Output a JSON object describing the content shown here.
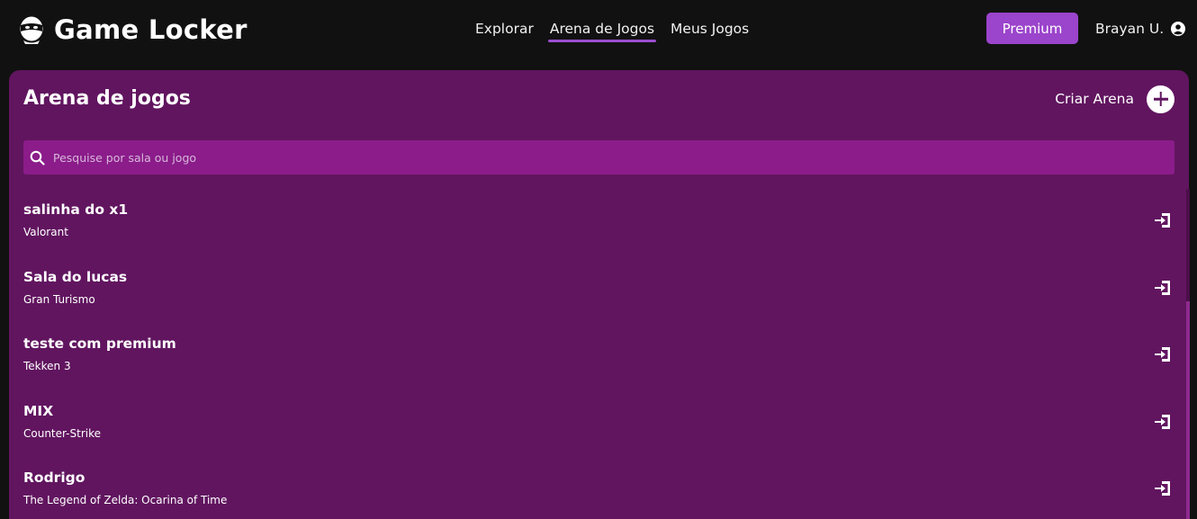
{
  "app": {
    "name": "Game Locker"
  },
  "nav": {
    "items": [
      {
        "label": "Explorar",
        "active": false
      },
      {
        "label": "Arena de Jogos",
        "active": true
      },
      {
        "label": "Meus Jogos",
        "active": false
      }
    ]
  },
  "header": {
    "premium_label": "Premium",
    "user_name": "Brayan U.",
    "user_icon": "user-circle-icon"
  },
  "arena": {
    "title": "Arena de jogos",
    "create_label": "Criar Arena",
    "search_placeholder": "Pesquise por sala ou jogo",
    "search_value": "",
    "rooms": [
      {
        "name": "salinha do x1",
        "game": "Valorant"
      },
      {
        "name": "Sala do lucas",
        "game": "Gran Turismo"
      },
      {
        "name": "teste com premium",
        "game": "Tekken 3"
      },
      {
        "name": "MIX",
        "game": "Counter-Strike"
      },
      {
        "name": "Rodrigo",
        "game": "The Legend of Zelda: Ocarina of Time"
      }
    ]
  },
  "colors": {
    "background": "#111111",
    "panel": "#61155f",
    "search": "#8b1c8a",
    "accent": "#9b44cc"
  }
}
